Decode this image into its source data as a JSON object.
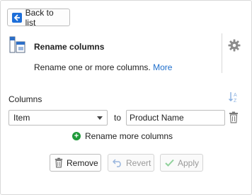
{
  "back_label": "Back to list",
  "title": "Rename columns",
  "description": "Rename one or more columns.",
  "more_link": "More",
  "columns_label": "Columns",
  "rename_row": {
    "from_value": "Item",
    "to_label": "to",
    "to_value": "Product Name"
  },
  "add_more_label": "Rename more columns",
  "buttons": {
    "remove": "Remove",
    "revert": "Revert",
    "apply": "Apply"
  },
  "colors": {
    "accent": "#1e6fd9",
    "add": "#1f9a3a",
    "apply_check": "#4caf50",
    "disabled_text": "#9a9a9a"
  }
}
